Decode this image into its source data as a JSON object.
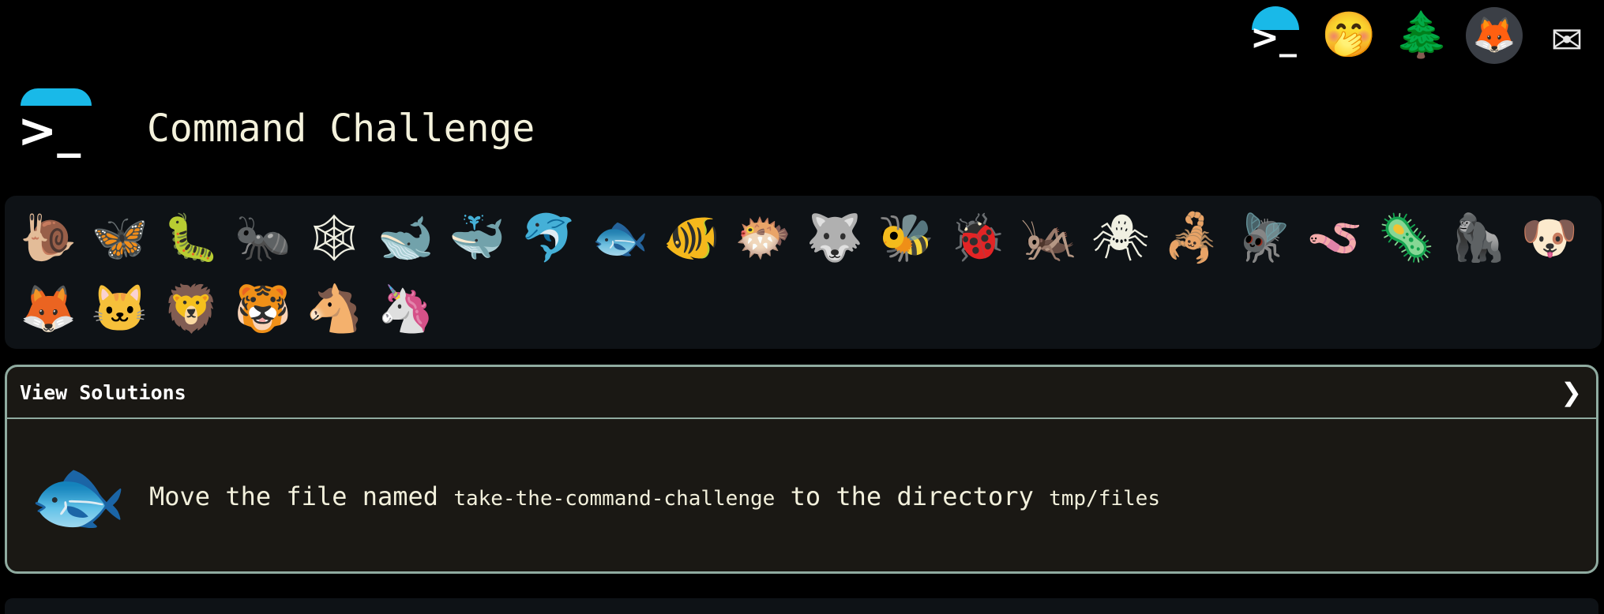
{
  "topbar": {
    "icons": [
      {
        "name": "command-challenge-logo-icon",
        "glyph": ">_"
      },
      {
        "name": "shushing-face-icon",
        "glyph": "🤭"
      },
      {
        "name": "tree-icon",
        "glyph": "🌲"
      },
      {
        "name": "gitlab-icon",
        "glyph": "🦊"
      },
      {
        "name": "mail-icon",
        "glyph": "✉"
      }
    ]
  },
  "header": {
    "logo_glyph": ">_",
    "title": "Command Challenge"
  },
  "animals": [
    {
      "name": "snail",
      "glyph": "🐌"
    },
    {
      "name": "butterfly",
      "glyph": "🦋"
    },
    {
      "name": "caterpillar",
      "glyph": "🐛"
    },
    {
      "name": "ant",
      "glyph": "🐜"
    },
    {
      "name": "spider-web",
      "glyph": "🕸"
    },
    {
      "name": "whale",
      "glyph": "🐋"
    },
    {
      "name": "spouting-whale",
      "glyph": "🐳"
    },
    {
      "name": "dolphin",
      "glyph": "🐬"
    },
    {
      "name": "fish",
      "glyph": "🐟"
    },
    {
      "name": "tropical-fish",
      "glyph": "🐠"
    },
    {
      "name": "blowfish",
      "glyph": "🐡"
    },
    {
      "name": "wolf",
      "glyph": "🐺"
    },
    {
      "name": "bee",
      "glyph": "🐝"
    },
    {
      "name": "ladybug",
      "glyph": "🐞"
    },
    {
      "name": "cricket",
      "glyph": "🦗"
    },
    {
      "name": "spider",
      "glyph": "🕷"
    },
    {
      "name": "scorpion",
      "glyph": "🦂"
    },
    {
      "name": "fly",
      "glyph": "🪰"
    },
    {
      "name": "worm",
      "glyph": "🪱"
    },
    {
      "name": "microbe",
      "glyph": "🦠"
    },
    {
      "name": "gorilla",
      "glyph": "🦍"
    },
    {
      "name": "dog",
      "glyph": "🐶"
    },
    {
      "name": "fox",
      "glyph": "🦊"
    },
    {
      "name": "cat",
      "glyph": "🐱"
    },
    {
      "name": "lion",
      "glyph": "🦁"
    },
    {
      "name": "tiger",
      "glyph": "🐯"
    },
    {
      "name": "horse",
      "glyph": "🐴"
    },
    {
      "name": "unicorn",
      "glyph": "🦄"
    }
  ],
  "solutions_panel": {
    "label": "View Solutions",
    "chevron": "❯"
  },
  "challenge": {
    "icon_glyph": "🐟",
    "text_before": "Move the file named ",
    "file_name": "take-the-command-challenge",
    "text_middle": " to the directory ",
    "directory": "tmp/files"
  }
}
